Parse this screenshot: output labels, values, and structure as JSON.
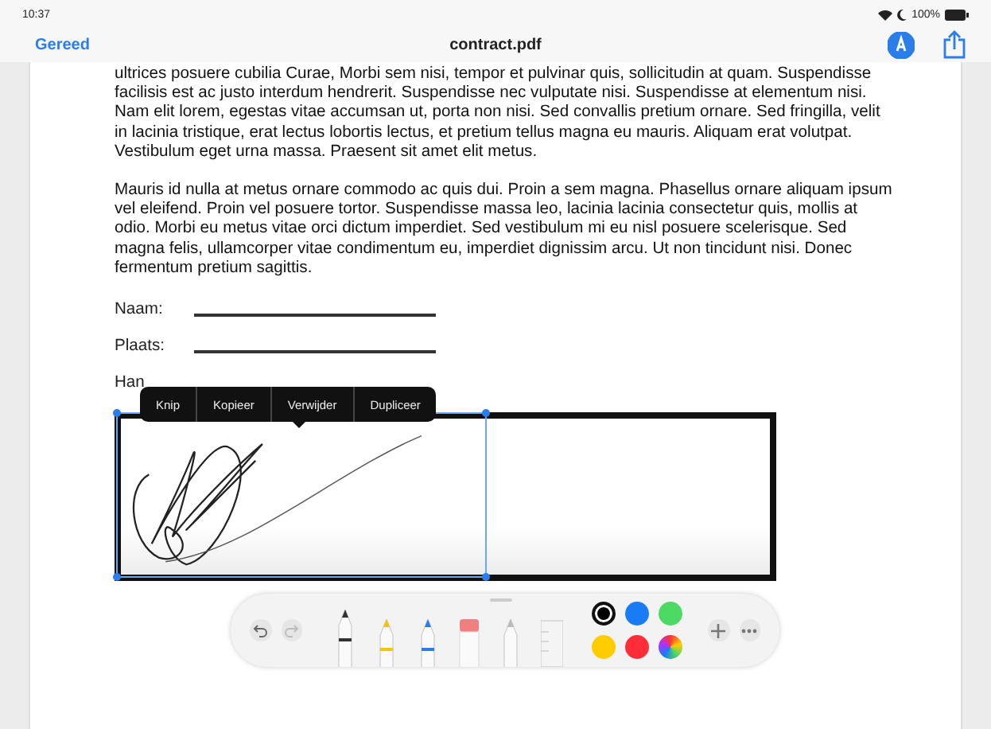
{
  "status_bar": {
    "time": "10:37",
    "battery": "100%"
  },
  "nav": {
    "done": "Gereed",
    "title": "contract.pdf",
    "markup_on": true
  },
  "paragraphs": [
    "ultrices posuere cubilia Curae, Morbi sem nisi, tempor et pulvinar quis, sollicitudin at quam. Suspendisse facilisis est ac justo interdum hendrerit. Suspendisse nec vulputate nisi. Suspendisse at elementum nisi. Nam elit lorem, egestas vitae accumsan ut, porta non nisi. Sed convallis pretium ornare. Sed fringilla, velit in lacinia tristique, erat lectus lobortis lectus, et pretium tellus magna eu mauris. Aliquam erat volutpat. Vestibulum eget urna massa. Praesent sit amet elit metus.",
    "Mauris id nulla at metus ornare commodo ac quis dui. Proin a sem magna. Phasellus ornare aliquam ipsum vel eleifend. Proin vel posuere tortor. Suspendisse massa leo, lacinia lacinia consectetur quis, mollis at odio. Morbi eu metus vitae orci dictum imperdiet. Sed vestibulum mi eu nisl posuere scelerisque. Sed magna felis, ullamcorper vitae condimentum eu, imperdiet dignissim arcu. Ut non tincidunt nisi. Donec fermentum pretium sagittis."
  ],
  "fields": [
    {
      "label": "Naam:"
    },
    {
      "label": "Plaats:"
    },
    {
      "label": "Han"
    }
  ],
  "context_menu": [
    "Knip",
    "Kopieer",
    "Verwijder",
    "Dupliceer"
  ],
  "tools": [
    {
      "kind": "pen",
      "selected": true
    },
    {
      "kind": "marker",
      "selected": false
    },
    {
      "kind": "pencil",
      "selected": false
    },
    {
      "kind": "eraser",
      "selected": false
    },
    {
      "kind": "lasso",
      "selected": false
    },
    {
      "kind": "ruler",
      "selected": false
    }
  ],
  "colors": [
    {
      "color": "#000000",
      "selected": true
    },
    {
      "color": "#1a7cf5",
      "selected": false
    },
    {
      "color": "#4cd964",
      "selected": false
    },
    {
      "color": "#ffcc00",
      "selected": false
    },
    {
      "color": "#ff2d3a",
      "selected": false
    },
    {
      "kind": "wheel",
      "selected": false
    }
  ]
}
